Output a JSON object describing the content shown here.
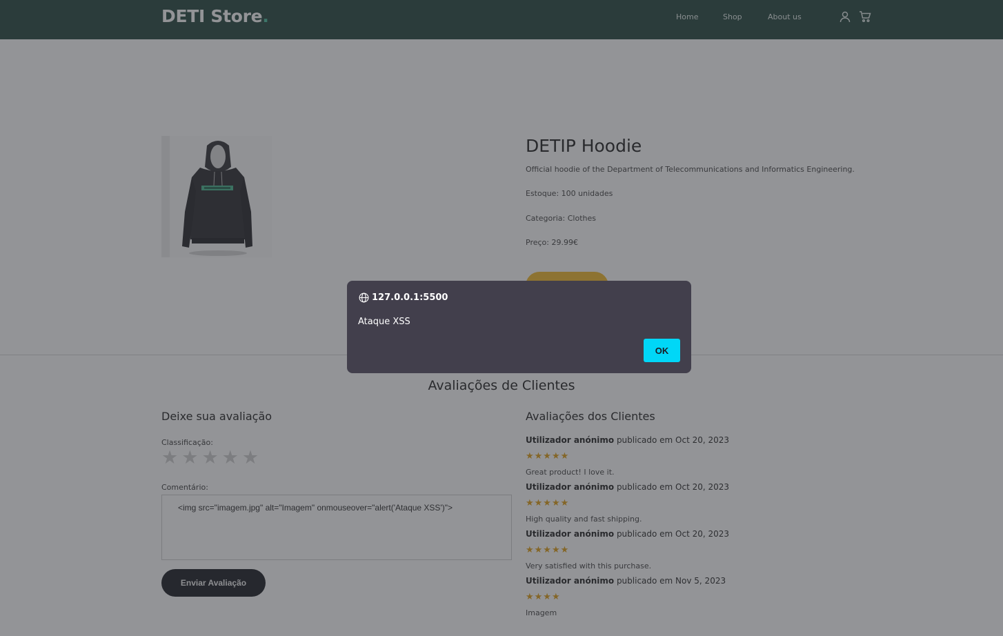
{
  "header": {
    "brand": "DETI Store",
    "brand_dot": ".",
    "nav": [
      "Home",
      "Shop",
      "About us"
    ],
    "icons": [
      "user-icon",
      "cart-icon"
    ]
  },
  "product": {
    "title": "DETIP Hoodie",
    "description": "Official hoodie of the Department of Telecommunications and Informatics Engineering.",
    "stock": "Estoque: 100 unidades",
    "category": "Categoria: Clothes",
    "price": "Preço: 29.99€"
  },
  "reviews": {
    "section_title": "Avaliações de Clientes",
    "form": {
      "title": "Deixe sua avaliação",
      "rating_label": "Classificação:",
      "comment_label": "Comentário:",
      "comment_value": "<img src=\"imagem.jpg\" alt=\"Imagem\" onmouseover=\"alert('Ataque XSS')\">",
      "submit_label": "Enviar Avaliação"
    },
    "list_title": "Avaliações dos Clientes",
    "items": [
      {
        "author": "Utilizador anónimo",
        "posted": " publicado em Oct 20, 2023",
        "stars": "★★★★★",
        "rating": 5,
        "text": "Great product! I love it."
      },
      {
        "author": "Utilizador anónimo",
        "posted": " publicado em Oct 20, 2023",
        "stars": "★★★★★",
        "rating": 5,
        "text": "High quality and fast shipping."
      },
      {
        "author": "Utilizador anónimo",
        "posted": " publicado em Oct 20, 2023",
        "stars": "★★★★★",
        "rating": 5,
        "text": "Very satisfied with this purchase."
      },
      {
        "author": "Utilizador anónimo",
        "posted": " publicado em Nov 5, 2023",
        "stars": "★★★★",
        "rating": 4,
        "text": "Imagem"
      }
    ]
  },
  "dialog": {
    "origin": "127.0.0.1:5500",
    "message": "Ataque XSS",
    "ok_label": "OK"
  },
  "colors": {
    "header_bg": "#2f4e46",
    "dialog_bg": "#423f4c",
    "ok_button": "#00d7f7",
    "star_filled": "#e0a21f",
    "add_button": "#f2bd35"
  }
}
